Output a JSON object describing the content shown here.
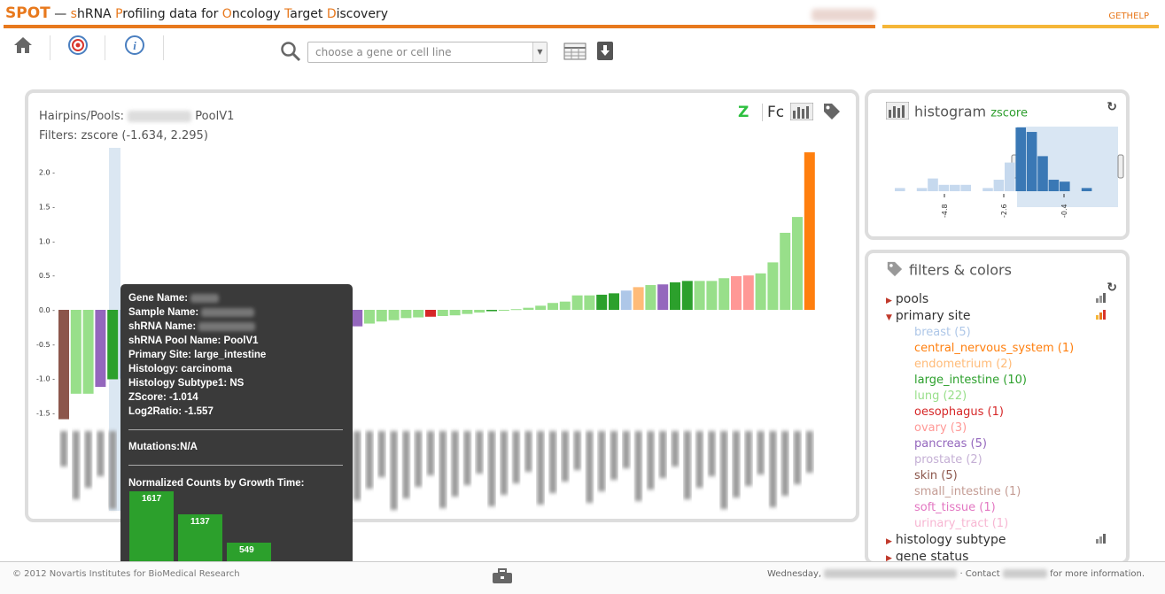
{
  "header": {
    "brand": "SPOT",
    "dash": " — ",
    "parts": [
      {
        "t": "s",
        "hl": true
      },
      {
        "t": "hRNA ",
        "hl": false
      },
      {
        "t": "P",
        "hl": true
      },
      {
        "t": "rofiling data for ",
        "hl": false
      },
      {
        "t": "O",
        "hl": true
      },
      {
        "t": "ncology ",
        "hl": false
      },
      {
        "t": "T",
        "hl": true
      },
      {
        "t": "arget ",
        "hl": false
      },
      {
        "t": "D",
        "hl": true
      },
      {
        "t": "iscovery",
        "hl": false
      }
    ],
    "gethelp": "GETHELP",
    "accent": "#e8791d"
  },
  "toolbar": {
    "search_placeholder": "choose a gene or cell line",
    "icons": [
      "home-icon",
      "target-icon",
      "info-icon",
      "search-icon",
      "table-icon",
      "download-icon"
    ]
  },
  "main": {
    "hairpins_label": "Hairpins/Pools:",
    "pool": "PoolV1",
    "filters_label": "Filters: zscore (-1.634, 2.295)",
    "z_toggle": "Z",
    "fc_toggle": "Fc"
  },
  "chart_data": {
    "type": "bar",
    "ylabel": "",
    "ylim": [
      -1.634,
      2.295
    ],
    "yticks": [
      "2.0",
      "1.5",
      "1.0",
      "0.5",
      "0.0",
      "-0.5",
      "-1.0",
      "-1.5"
    ],
    "values": [
      -1.59,
      -1.22,
      -1.22,
      -1.12,
      -1.01,
      -1.0,
      -0.92,
      -0.88,
      -0.84,
      -0.8,
      -0.76,
      -0.74,
      -0.72,
      -0.69,
      -0.66,
      -0.63,
      -0.56,
      -0.46,
      -0.44,
      -0.44,
      -0.42,
      -0.42,
      -0.38,
      -0.32,
      -0.24,
      -0.2,
      -0.17,
      -0.15,
      -0.12,
      -0.11,
      -0.1,
      -0.09,
      -0.08,
      -0.06,
      -0.04,
      -0.02,
      -0.01,
      0.01,
      0.03,
      0.06,
      0.1,
      0.12,
      0.21,
      0.21,
      0.22,
      0.24,
      0.28,
      0.33,
      0.36,
      0.37,
      0.4,
      0.42,
      0.42,
      0.42,
      0.46,
      0.49,
      0.5,
      0.53,
      0.69,
      1.12,
      1.35,
      2.29
    ],
    "colors": [
      "#8c564b",
      "#98df8a",
      "#98df8a",
      "#9467bd",
      "#2ca02c",
      "#aec7e8",
      "#8c564b",
      "#2ca02c",
      "#98df8a",
      "#98df8a",
      "#2ca02c",
      "#98df8a",
      "#8c564b",
      "#8c564b",
      "#2ca02c",
      "#98df8a",
      "#2ca02c",
      "#2ca02c",
      "#ff9896",
      "#8c564b",
      "#9467bd",
      "#2ca02c",
      "#2ca02c",
      "#e377c2",
      "#9467bd",
      "#98df8a",
      "#98df8a",
      "#98df8a",
      "#98df8a",
      "#98df8a",
      "#d62728",
      "#98df8a",
      "#98df8a",
      "#98df8a",
      "#98df8a",
      "#2ca02c",
      "#98df8a",
      "#98df8a",
      "#98df8a",
      "#98df8a",
      "#98df8a",
      "#98df8a",
      "#98df8a",
      "#98df8a",
      "#2ca02c",
      "#2ca02c",
      "#aec7e8",
      "#ffbb78",
      "#98df8a",
      "#9467bd",
      "#2ca02c",
      "#2ca02c",
      "#98df8a",
      "#98df8a",
      "#98df8a",
      "#ff9896",
      "#ff9896",
      "#98df8a",
      "#98df8a",
      "#98df8a",
      "#98df8a",
      "#ff7f0e"
    ],
    "highlighted_index": 4
  },
  "tooltip": {
    "gene_name_label": "Gene Name:",
    "sample_name_label": "Sample Name:",
    "shrna_name_label": "shRNA Name:",
    "pool_line": "shRNA Pool Name: PoolV1",
    "primary_site_line": "Primary Site: large_intestine",
    "histology_line": "Histology: carcinoma",
    "subtype_line": "Histology Subtype1: NS",
    "zscore_line": "ZScore: -1.014",
    "log2_line": "Log2Ratio: -1.557",
    "mutations_label": "Mutations:",
    "mutations_value": "N/A",
    "counts_title": "Normalized Counts by Growth Time:",
    "counts": [
      {
        "label": "1617",
        "value": 1617
      },
      {
        "label": "1137",
        "value": 1137
      },
      {
        "label": "549",
        "value": 549
      }
    ]
  },
  "histogram": {
    "title": "histogram",
    "metric": "zscore",
    "ticks": [
      "-4.8",
      "-2.6",
      "-0.4"
    ],
    "bins": [
      0.05,
      0,
      0.05,
      0.2,
      0.1,
      0.1,
      0.1,
      0,
      0.05,
      0.18,
      0.45,
      1.0,
      0.93,
      0.55,
      0.18,
      0.15,
      0,
      0.05
    ]
  },
  "filters": {
    "title": "filters & colors",
    "pools": "pools",
    "primary_site": "primary site",
    "sites": [
      {
        "name": "breast (5)",
        "color": "#aec7e8"
      },
      {
        "name": "central_nervous_system (1)",
        "color": "#ff7f0e"
      },
      {
        "name": "endometrium (2)",
        "color": "#ffbb78"
      },
      {
        "name": "large_intestine (10)",
        "color": "#2ca02c"
      },
      {
        "name": "lung (22)",
        "color": "#98df8a"
      },
      {
        "name": "oesophagus (1)",
        "color": "#d62728"
      },
      {
        "name": "ovary (3)",
        "color": "#ff9896"
      },
      {
        "name": "pancreas (5)",
        "color": "#9467bd"
      },
      {
        "name": "prostate (2)",
        "color": "#c5b0d5"
      },
      {
        "name": "skin (5)",
        "color": "#8c564b"
      },
      {
        "name": "small_intestine (1)",
        "color": "#c49c94"
      },
      {
        "name": "soft_tissue (1)",
        "color": "#e377c2"
      },
      {
        "name": "urinary_tract (1)",
        "color": "#f7b6d2"
      }
    ],
    "histology_subtype": "histology subtype",
    "gene_status": "gene status"
  },
  "footer": {
    "copyright": "© 2012 Novartis Institutes for BioMedical Research",
    "date_prefix": "Wednesday,",
    "contact_prefix": "· Contact",
    "contact_suffix": "for more information."
  }
}
